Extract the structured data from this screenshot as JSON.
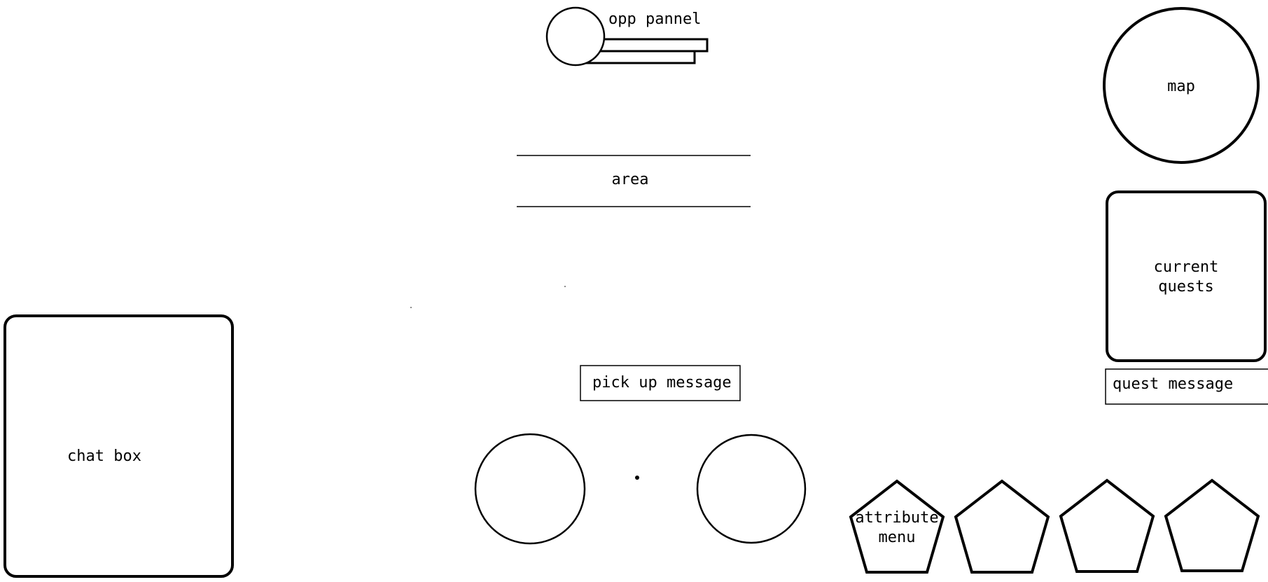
{
  "labels": {
    "opp_panel": "opp pannel",
    "map": "map",
    "area": "area",
    "current_quests_line1": "current",
    "current_quests_line2": "quests",
    "pick_up_message": "pick up message",
    "quest_message": "quest message",
    "chat_box": "chat box",
    "attribute_menu_line1": "attribute",
    "attribute_menu_line2": "menu"
  },
  "colors": {
    "stroke": "#000000",
    "background": "#ffffff"
  }
}
